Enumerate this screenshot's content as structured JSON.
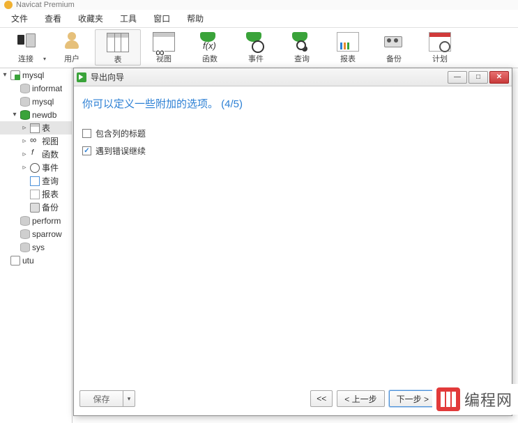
{
  "app": {
    "title": "Navicat Premium"
  },
  "menu": {
    "items": [
      "文件",
      "查看",
      "收藏夹",
      "工具",
      "窗口",
      "帮助"
    ]
  },
  "toolbar": {
    "items": [
      {
        "label": "连接",
        "icon": "connection-icon",
        "dd": true
      },
      {
        "label": "用户",
        "icon": "user-icon"
      },
      {
        "label": "表",
        "icon": "table-icon",
        "active": true
      },
      {
        "label": "视图",
        "icon": "view-icon"
      },
      {
        "label": "函数",
        "icon": "function-icon"
      },
      {
        "label": "事件",
        "icon": "event-icon"
      },
      {
        "label": "查询",
        "icon": "query-icon"
      },
      {
        "label": "报表",
        "icon": "report-icon"
      },
      {
        "label": "备份",
        "icon": "backup-icon"
      },
      {
        "label": "计划",
        "icon": "schedule-icon"
      }
    ]
  },
  "tree": {
    "nodes": [
      {
        "label": "mysql",
        "level": 1,
        "exp": "▾",
        "icon": "server-green-icon"
      },
      {
        "label": "informat",
        "level": 2,
        "exp": "",
        "icon": "db-icon"
      },
      {
        "label": "mysql",
        "level": 2,
        "exp": "",
        "icon": "db-icon"
      },
      {
        "label": "newdb",
        "level": 2,
        "exp": "▾",
        "icon": "db-green-icon"
      },
      {
        "label": "表",
        "level": 3,
        "exp": "▹",
        "icon": "table-small-icon",
        "sel": true
      },
      {
        "label": "视图",
        "level": 3,
        "exp": "▹",
        "icon": "view-small-icon"
      },
      {
        "label": "函数",
        "level": 3,
        "exp": "▹",
        "icon": "fx-small-icon"
      },
      {
        "label": "事件",
        "level": 3,
        "exp": "▹",
        "icon": "clock-small-icon"
      },
      {
        "label": "查询",
        "level": 3,
        "exp": "",
        "icon": "query-small-icon"
      },
      {
        "label": "报表",
        "level": 3,
        "exp": "",
        "icon": "report-small-icon"
      },
      {
        "label": "备份",
        "level": 3,
        "exp": "",
        "icon": "backup-small-icon"
      },
      {
        "label": "perform",
        "level": 2,
        "exp": "",
        "icon": "db-icon"
      },
      {
        "label": "sparrow",
        "level": 2,
        "exp": "",
        "icon": "db-icon"
      },
      {
        "label": "sys",
        "level": 2,
        "exp": "",
        "icon": "db-icon"
      },
      {
        "label": "utu",
        "level": 1,
        "exp": "",
        "icon": "server-icon"
      }
    ]
  },
  "dialog": {
    "title": "导出向导",
    "heading": "你可以定义一些附加的选项。 (4/5)",
    "opt_include_header": "包含列的标题",
    "opt_continue_on_error": "遇到错误继续",
    "save": "保存",
    "first": "<<",
    "prev": "< 上一步",
    "next": "下一步 >",
    "last": ">>",
    "win_min": "—",
    "win_max": "□",
    "win_close": "✕"
  },
  "watermark": {
    "text": "编程网"
  }
}
